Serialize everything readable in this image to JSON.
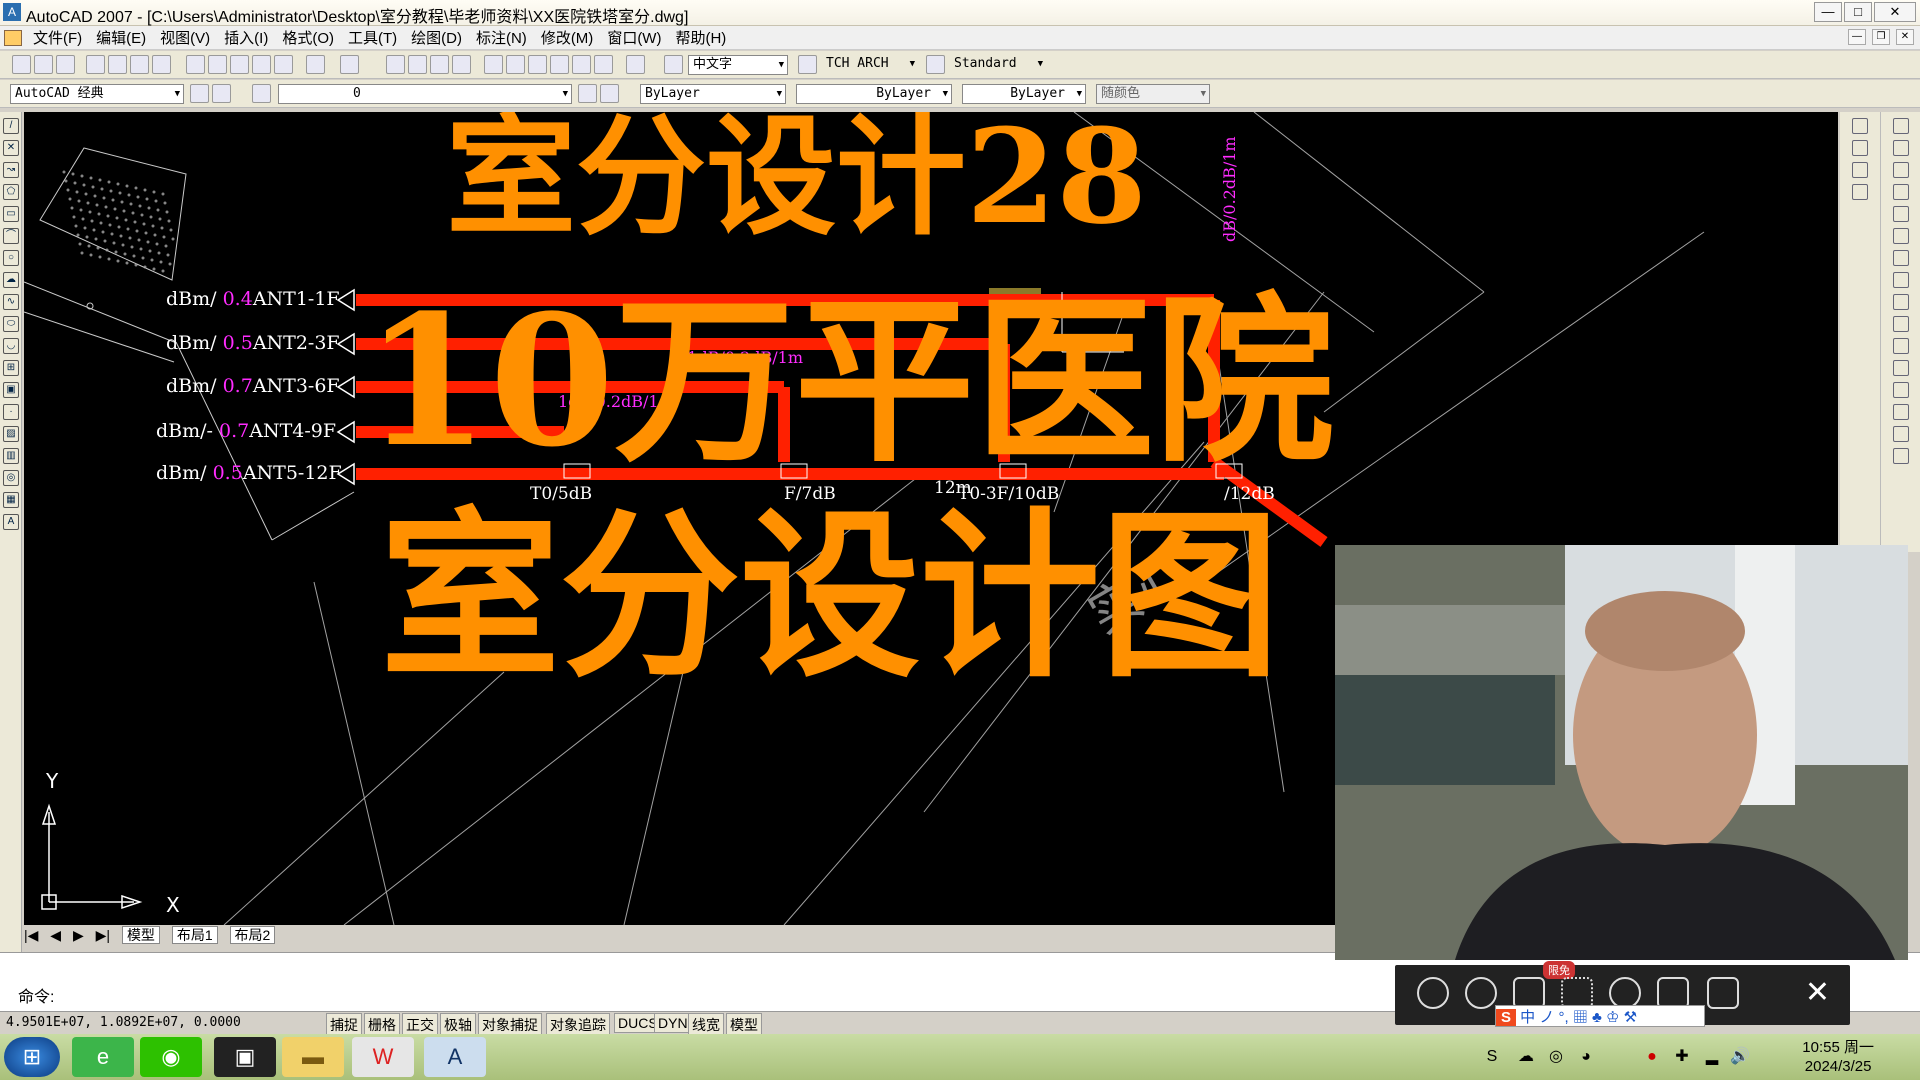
{
  "window": {
    "title": "AutoCAD 2007 - [C:\\Users\\Administrator\\Desktop\\室分教程\\毕老师资料\\XX医院铁塔室分.dwg]",
    "min": "—",
    "max": "□",
    "close": "✕"
  },
  "menu": [
    "文件(F)",
    "编辑(E)",
    "视图(V)",
    "插入(I)",
    "格式(O)",
    "工具(T)",
    "绘图(D)",
    "标注(N)",
    "修改(M)",
    "窗口(W)",
    "帮助(H)"
  ],
  "toolbar1": {
    "text_style": "中文字",
    "tch": "TCH ARCH",
    "dim_style": "Standard"
  },
  "toolbar2": {
    "workspace": "AutoCAD 经典",
    "layer": "0",
    "color": "ByLayer",
    "linetype": "ByLayer",
    "lineweight": "ByLayer",
    "plotstyle": "随颜色"
  },
  "overlay": {
    "line1": "室分设计28",
    "line2": "10万平医院",
    "line3": "室分设计图"
  },
  "antennas": [
    {
      "prefix": "dBm/",
      "value": "0.4",
      "name": "ANT1-1F"
    },
    {
      "prefix": "dBm/",
      "value": "0.5",
      "name": "ANT2-3F"
    },
    {
      "prefix": "dBm/",
      "value": "0.7",
      "name": "ANT3-6F"
    },
    {
      "prefix": "dBm/-",
      "value": "0.7",
      "name": "ANT4-9F"
    },
    {
      "prefix": "dBm/",
      "value": "0.5",
      "name": "ANT5-12F"
    }
  ],
  "drawing_labels": {
    "a": "0.1dB/0.2dB/1m",
    "b": "1dB/0.2dB/1",
    "c": "dB/0.2dB/1m",
    "d": "T0/5dB",
    "e": "T0-3F/10dB",
    "f": "F/7dB",
    "g": "/12dB",
    "h": "12m",
    "i": "实心"
  },
  "tabs": {
    "model": "模型",
    "layout1": "布局1",
    "layout2": "布局2"
  },
  "command": {
    "prompt": "命令:"
  },
  "status": {
    "coords": "4.9501E+07, 1.0892E+07, 0.0000",
    "buttons": [
      "捕捉",
      "栅格",
      "正交",
      "极轴",
      "对象捕捉",
      "对象追踪",
      "DUCS",
      "DYN",
      "线宽",
      "模型"
    ]
  },
  "floatbar": {
    "badge": "限免"
  },
  "ime": {
    "text": "中 ノ °, ▦ ♣ ♔ ⚒"
  },
  "clock": {
    "time": "10:55 周一",
    "date": "2024/3/25"
  },
  "colors": {
    "overlay": "#ff9000",
    "cable": "#ff2000",
    "magenta": "#ff2cff"
  }
}
